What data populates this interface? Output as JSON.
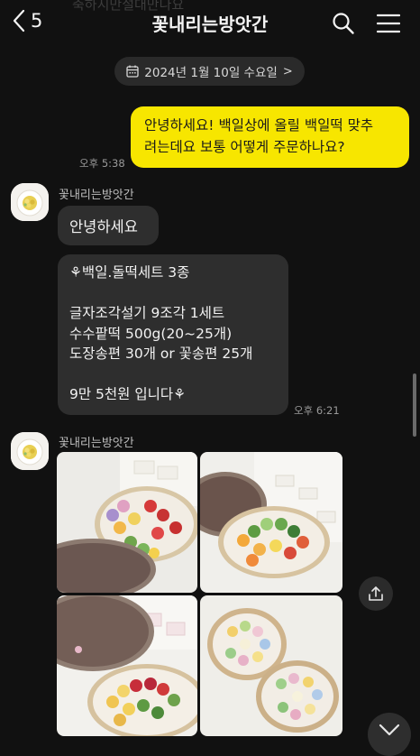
{
  "header": {
    "back_count": "5",
    "title": "꽃내리는방앗간",
    "ghost_text": "축하지만절대만나요",
    "icons": {
      "back": "chevron-left-icon",
      "search": "search-icon",
      "menu": "hamburger-menu-icon"
    }
  },
  "date_divider": {
    "text": "2024년 1월 10일 수요일",
    "icon": "calendar-icon",
    "chevron": ">"
  },
  "messages": {
    "outgoing": {
      "line1": "안녕하세요! 백일상에 올릴 백일떡 맞추",
      "line2": "려는데요 보통 어떻게 주문하나요?",
      "time": "오후 5:38",
      "color": "#f7e600"
    },
    "incoming1": {
      "sender": "꽃내리는방앗간",
      "greeting": "안녕하세요",
      "lines": [
        "⚘백일.돌떡세트 3종",
        "",
        "글자조각설기 9조각 1세트",
        "수수팥떡 500g(20~25개)",
        "도장송편 30개 or 꽃송편 25개",
        "",
        "9만 5천원 입니다⚘"
      ],
      "time": "오후 6:21"
    },
    "incoming2": {
      "sender": "꽃내리는방앗간",
      "photos": [
        "rice-cake-set-photo-1",
        "rice-cake-set-photo-2",
        "rice-cake-set-photo-3",
        "rice-cake-set-photo-4"
      ],
      "share_icon": "share-icon"
    }
  },
  "scroll_down_icon": "chevron-down-icon",
  "colors": {
    "background": "#111111",
    "bubble_incoming": "#2e2e2e",
    "bubble_outgoing": "#f7e600"
  }
}
